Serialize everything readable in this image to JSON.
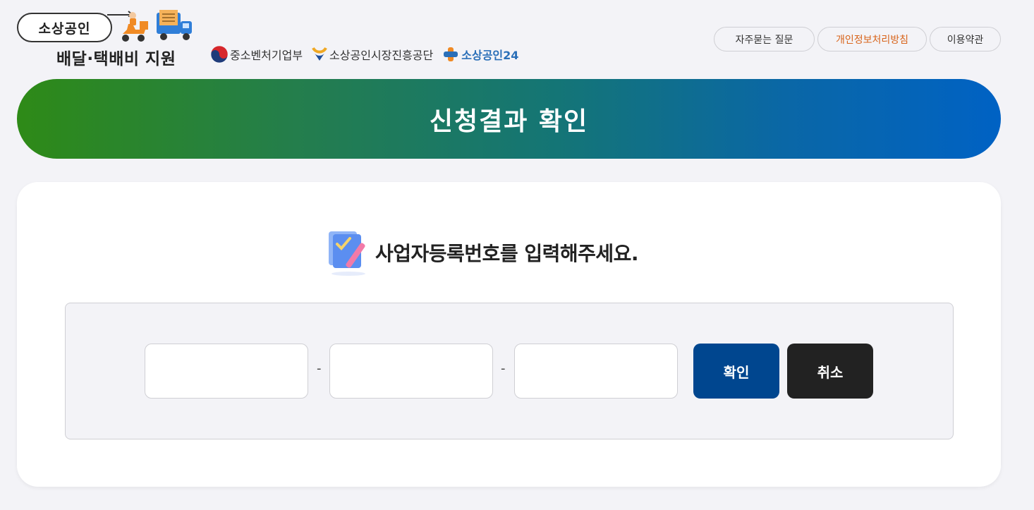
{
  "header": {
    "logo_pill": "소상공인",
    "logo_title": "배달·택배비 지원",
    "agencies": [
      {
        "label": "중소벤처기업부",
        "icon": "korea-taegeuk-icon"
      },
      {
        "label": "소상공인시장진흥공단",
        "icon": "semas-logo-icon"
      },
      {
        "label": "소상공인24",
        "icon": "sbiz24-logo-icon"
      }
    ],
    "links": [
      {
        "label": "자주묻는 질문"
      },
      {
        "label": "개인정보처리방침",
        "color": "#d8641b"
      },
      {
        "label": "이용약관"
      }
    ]
  },
  "banner": {
    "title": "신청결과 확인"
  },
  "main": {
    "prompt": "사업자등록번호를 입력해주세요.",
    "prompt_icon": "checklist-pencil-icon",
    "inputs": [
      {
        "value": "",
        "placeholder": ""
      },
      {
        "value": "",
        "placeholder": ""
      },
      {
        "value": "",
        "placeholder": ""
      }
    ],
    "separator": "-",
    "confirm_label": "확인",
    "cancel_label": "취소"
  },
  "colors": {
    "banner_start": "#2e8a17",
    "banner_end": "#0062c4",
    "confirm_button": "#00468f",
    "cancel_button": "#222222",
    "privacy_link": "#d8641b"
  }
}
